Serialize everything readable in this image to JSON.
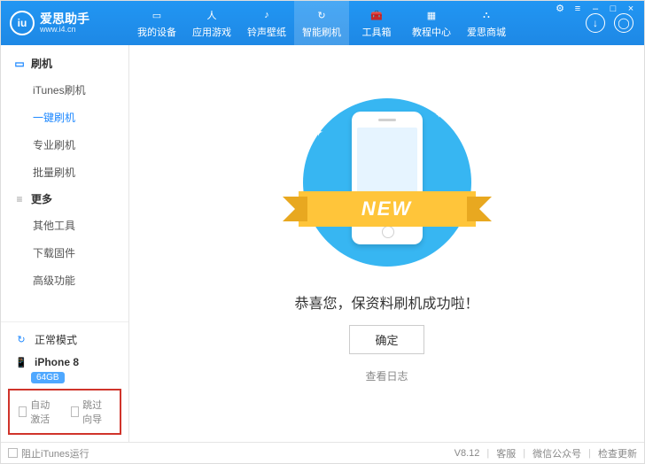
{
  "app": {
    "name": "爱思助手",
    "url": "www.i4.cn",
    "logo": "iu"
  },
  "winctrl": {
    "settings": "⚙",
    "menu": "≡",
    "min": "–",
    "max": "□",
    "close": "×"
  },
  "nav": [
    {
      "label": "我的设备",
      "icon": "▭"
    },
    {
      "label": "应用游戏",
      "icon": "人"
    },
    {
      "label": "铃声壁纸",
      "icon": "♪"
    },
    {
      "label": "智能刷机",
      "icon": "↻",
      "active": true
    },
    {
      "label": "工具箱",
      "icon": "🧰"
    },
    {
      "label": "教程中心",
      "icon": "▦"
    },
    {
      "label": "爱思商城",
      "icon": "⛬"
    }
  ],
  "headerRight": {
    "download": "↓",
    "user": "◯"
  },
  "sidebar": {
    "groups": [
      {
        "title": "刷机",
        "icon": "▭",
        "items": [
          "iTunes刷机",
          "一键刷机",
          "专业刷机",
          "批量刷机"
        ],
        "activeIndex": 1
      },
      {
        "title": "更多",
        "icon": "≡",
        "items": [
          "其他工具",
          "下载固件",
          "高级功能"
        ]
      }
    ],
    "mode": {
      "icon": "↻",
      "label": "正常模式"
    },
    "device": {
      "icon": "📱",
      "name": "iPhone 8",
      "storage": "64GB"
    },
    "checks": {
      "autoActivate": "自动激活",
      "skipWizard": "跳过向导"
    }
  },
  "main": {
    "ribbon": "NEW",
    "message": "恭喜您，保资料刷机成功啦！",
    "ok": "确定",
    "viewLog": "查看日志"
  },
  "footer": {
    "blockItunes": "阻止iTunes运行",
    "version": "V8.12",
    "support": "客服",
    "wechat": "微信公众号",
    "update": "检查更新"
  }
}
